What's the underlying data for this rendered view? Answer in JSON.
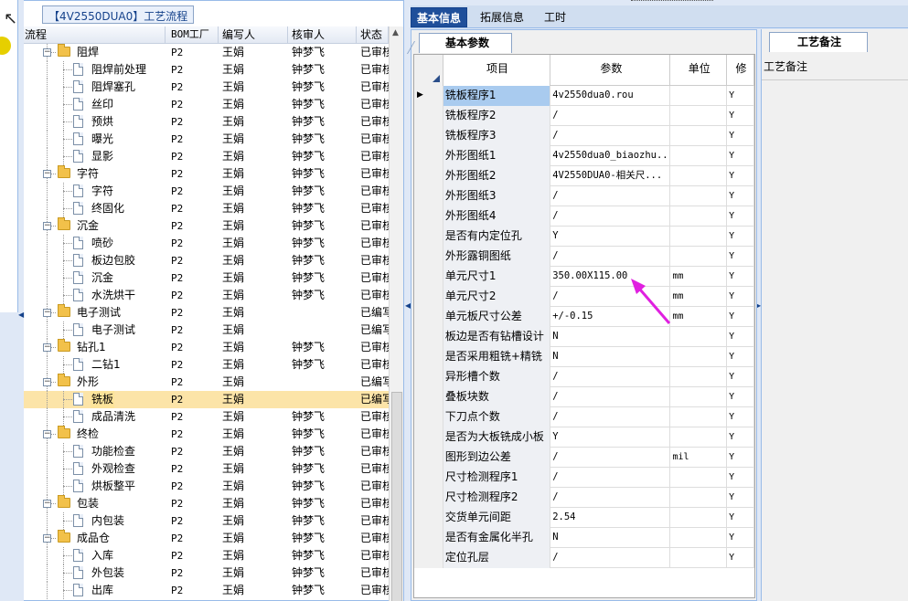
{
  "tree_panel": {
    "title": "【4V2550DUA0】工艺流程",
    "columns": [
      "流程",
      "BOM工厂",
      "编写人",
      "核审人",
      "状态"
    ],
    "rows": [
      {
        "label": "阻焊",
        "type": "folder",
        "bom": "P2",
        "author": "王娟",
        "reviewer": "钟梦飞",
        "status": "已审核"
      },
      {
        "label": "阻焊前处理",
        "type": "doc",
        "bom": "P2",
        "author": "王娟",
        "reviewer": "钟梦飞",
        "status": "已审核"
      },
      {
        "label": "阻焊塞孔",
        "type": "doc",
        "bom": "P2",
        "author": "王娟",
        "reviewer": "钟梦飞",
        "status": "已审核"
      },
      {
        "label": "丝印",
        "type": "doc",
        "bom": "P2",
        "author": "王娟",
        "reviewer": "钟梦飞",
        "status": "已审核"
      },
      {
        "label": "预烘",
        "type": "doc",
        "bom": "P2",
        "author": "王娟",
        "reviewer": "钟梦飞",
        "status": "已审核"
      },
      {
        "label": "曝光",
        "type": "doc",
        "bom": "P2",
        "author": "王娟",
        "reviewer": "钟梦飞",
        "status": "已审核"
      },
      {
        "label": "显影",
        "type": "doc",
        "bom": "P2",
        "author": "王娟",
        "reviewer": "钟梦飞",
        "status": "已审核"
      },
      {
        "label": "字符",
        "type": "folder",
        "bom": "P2",
        "author": "王娟",
        "reviewer": "钟梦飞",
        "status": "已审核"
      },
      {
        "label": "字符",
        "type": "doc",
        "bom": "P2",
        "author": "王娟",
        "reviewer": "钟梦飞",
        "status": "已审核"
      },
      {
        "label": "终固化",
        "type": "doc",
        "bom": "P2",
        "author": "王娟",
        "reviewer": "钟梦飞",
        "status": "已审核"
      },
      {
        "label": "沉金",
        "type": "folder",
        "bom": "P2",
        "author": "王娟",
        "reviewer": "钟梦飞",
        "status": "已审核"
      },
      {
        "label": "喷砂",
        "type": "doc",
        "bom": "P2",
        "author": "王娟",
        "reviewer": "钟梦飞",
        "status": "已审核"
      },
      {
        "label": "板边包胶",
        "type": "doc",
        "bom": "P2",
        "author": "王娟",
        "reviewer": "钟梦飞",
        "status": "已审核"
      },
      {
        "label": "沉金",
        "type": "doc",
        "bom": "P2",
        "author": "王娟",
        "reviewer": "钟梦飞",
        "status": "已审核"
      },
      {
        "label": "水洗烘干",
        "type": "doc",
        "bom": "P2",
        "author": "王娟",
        "reviewer": "钟梦飞",
        "status": "已审核"
      },
      {
        "label": "电子测试",
        "type": "folder",
        "bom": "P2",
        "author": "王娟",
        "reviewer": "",
        "status": "已编写"
      },
      {
        "label": "电子测试",
        "type": "doc",
        "bom": "P2",
        "author": "王娟",
        "reviewer": "",
        "status": "已编写"
      },
      {
        "label": "钻孔1",
        "type": "folder",
        "bom": "P2",
        "author": "王娟",
        "reviewer": "钟梦飞",
        "status": "已审核"
      },
      {
        "label": "二钻1",
        "type": "doc",
        "bom": "P2",
        "author": "王娟",
        "reviewer": "钟梦飞",
        "status": "已审核"
      },
      {
        "label": "外形",
        "type": "folder",
        "bom": "P2",
        "author": "王娟",
        "reviewer": "",
        "status": "已编写"
      },
      {
        "label": "铣板",
        "type": "doc",
        "bom": "P2",
        "author": "王娟",
        "reviewer": "",
        "status": "已编写",
        "selected": true
      },
      {
        "label": "成品清洗",
        "type": "doc",
        "bom": "P2",
        "author": "王娟",
        "reviewer": "钟梦飞",
        "status": "已审核"
      },
      {
        "label": "终检",
        "type": "folder",
        "bom": "P2",
        "author": "王娟",
        "reviewer": "钟梦飞",
        "status": "已审核"
      },
      {
        "label": "功能检查",
        "type": "doc",
        "bom": "P2",
        "author": "王娟",
        "reviewer": "钟梦飞",
        "status": "已审核"
      },
      {
        "label": "外观检查",
        "type": "doc",
        "bom": "P2",
        "author": "王娟",
        "reviewer": "钟梦飞",
        "status": "已审核"
      },
      {
        "label": "烘板整平",
        "type": "doc",
        "bom": "P2",
        "author": "王娟",
        "reviewer": "钟梦飞",
        "status": "已审核"
      },
      {
        "label": "包装",
        "type": "folder",
        "bom": "P2",
        "author": "王娟",
        "reviewer": "钟梦飞",
        "status": "已审核"
      },
      {
        "label": "内包装",
        "type": "doc",
        "bom": "P2",
        "author": "王娟",
        "reviewer": "钟梦飞",
        "status": "已审核"
      },
      {
        "label": "成品仓",
        "type": "folder",
        "bom": "P2",
        "author": "王娟",
        "reviewer": "钟梦飞",
        "status": "已审核"
      },
      {
        "label": "入库",
        "type": "doc",
        "bom": "P2",
        "author": "王娟",
        "reviewer": "钟梦飞",
        "status": "已审核"
      },
      {
        "label": "外包装",
        "type": "doc",
        "bom": "P2",
        "author": "王娟",
        "reviewer": "钟梦飞",
        "status": "已审核"
      },
      {
        "label": "出库",
        "type": "doc",
        "bom": "P2",
        "author": "王娟",
        "reviewer": "钟梦飞",
        "status": "已审核"
      }
    ]
  },
  "tabs": [
    "基本信息",
    "拓展信息",
    "工时"
  ],
  "active_tab": 0,
  "basic_params": {
    "tab_label": "基本参数",
    "columns": [
      "项目",
      "参数",
      "单位",
      "修"
    ],
    "rows": [
      {
        "item": "铣板程序1",
        "value": "4v2550dua0.rou",
        "unit": "",
        "flag": "Y",
        "current": true
      },
      {
        "item": "铣板程序2",
        "value": "/",
        "unit": "",
        "flag": "Y"
      },
      {
        "item": "铣板程序3",
        "value": "/",
        "unit": "",
        "flag": "Y"
      },
      {
        "item": "外形图纸1",
        "value": "4v2550dua0_biaozhu...",
        "unit": "",
        "flag": "Y"
      },
      {
        "item": "外形图纸2",
        "value": "4V2550DUA0-相关尺...",
        "unit": "",
        "flag": "Y"
      },
      {
        "item": "外形图纸3",
        "value": "/",
        "unit": "",
        "flag": "Y"
      },
      {
        "item": "外形图纸4",
        "value": "/",
        "unit": "",
        "flag": "Y"
      },
      {
        "item": "是否有内定位孔",
        "value": "Y",
        "unit": "",
        "flag": "Y"
      },
      {
        "item": "外形露铜图纸",
        "value": "/",
        "unit": "",
        "flag": "Y"
      },
      {
        "item": "单元尺寸1",
        "value": "350.00X115.00",
        "unit": "mm",
        "flag": "Y"
      },
      {
        "item": "单元尺寸2",
        "value": "/",
        "unit": "mm",
        "flag": "Y"
      },
      {
        "item": "单元板尺寸公差",
        "value": "+/-0.15",
        "unit": "mm",
        "flag": "Y"
      },
      {
        "item": "板边是否有钻槽设计",
        "value": "N",
        "unit": "",
        "flag": "Y"
      },
      {
        "item": "是否采用粗铣+精铣",
        "value": "N",
        "unit": "",
        "flag": "Y"
      },
      {
        "item": "异形槽个数",
        "value": "/",
        "unit": "",
        "flag": "Y"
      },
      {
        "item": "叠板块数",
        "value": "/",
        "unit": "",
        "flag": "Y"
      },
      {
        "item": "下刀点个数",
        "value": "/",
        "unit": "",
        "flag": "Y"
      },
      {
        "item": "是否为大板铣成小板",
        "value": "Y",
        "unit": "",
        "flag": "Y"
      },
      {
        "item": "图形到边公差",
        "value": "/",
        "unit": "mil",
        "flag": "Y"
      },
      {
        "item": "尺寸检测程序1",
        "value": "/",
        "unit": "",
        "flag": "Y"
      },
      {
        "item": "尺寸检测程序2",
        "value": "/",
        "unit": "",
        "flag": "Y"
      },
      {
        "item": "交货单元间距",
        "value": "2.54",
        "unit": "",
        "flag": "Y"
      },
      {
        "item": "是否有金属化半孔",
        "value": "N",
        "unit": "",
        "flag": "Y"
      },
      {
        "item": "定位孔层",
        "value": "/",
        "unit": "",
        "flag": "Y"
      }
    ]
  },
  "process_notes": {
    "tab_label": "工艺备注",
    "field_label": "工艺备注"
  },
  "colors": {
    "selected_row": "#fce4a8",
    "active_tab": "#1f4f9a",
    "annotation_arrow": "#e020e0"
  }
}
